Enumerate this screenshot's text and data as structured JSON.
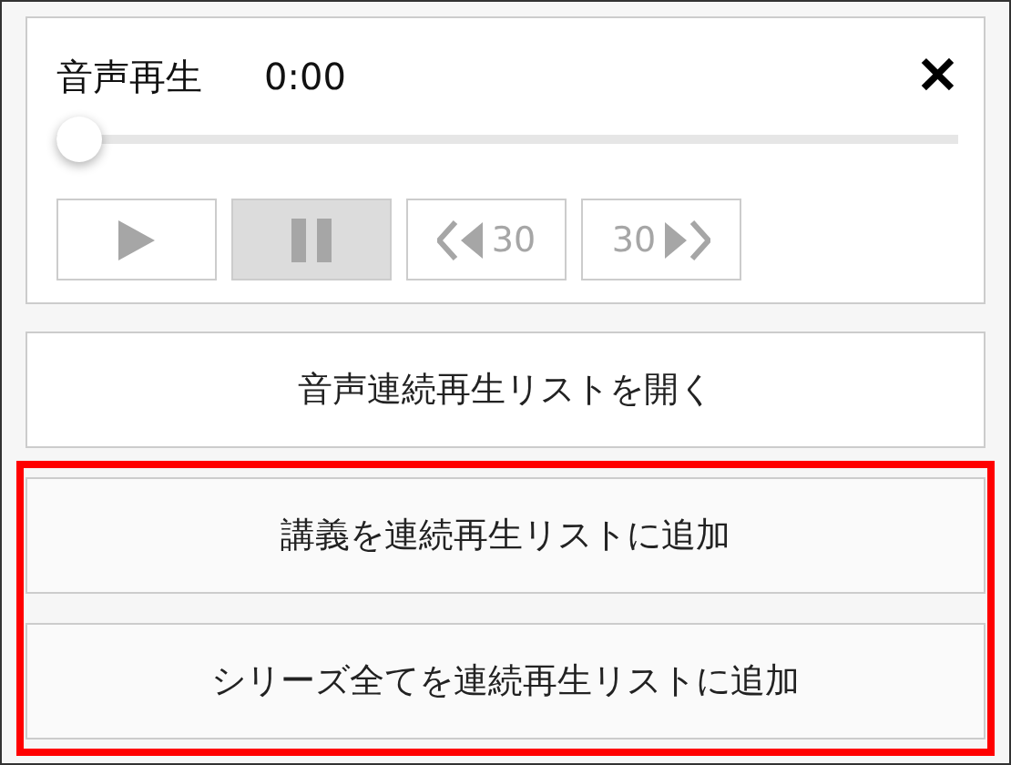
{
  "player": {
    "title": "音声再生",
    "time": "0:00",
    "close": "✕",
    "progress": {
      "level": 0
    },
    "controls": [
      {
        "kind": "play",
        "pressed": false
      },
      {
        "kind": "pause",
        "pressed": true
      },
      {
        "kind": "rewind",
        "label": "30",
        "pressed": false
      },
      {
        "kind": "forward",
        "label": "30",
        "pressed": false
      }
    ]
  },
  "open_button": "音声連続再生リストを開く",
  "highlighted_buttons": [
    "講義を連続再生リストに追加",
    "シリーズ全てを連続再生リストに追加"
  ]
}
